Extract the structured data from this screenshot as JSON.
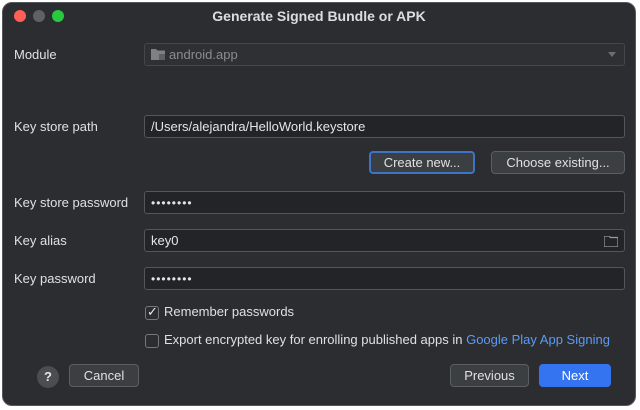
{
  "window": {
    "title": "Generate Signed Bundle or APK"
  },
  "icons": {
    "close": "close-traffic-light-icon",
    "minimize": "minimize-traffic-light-icon",
    "maximize": "maximize-traffic-light-icon",
    "module": "module-folder-icon",
    "browse": "folder-browse-icon",
    "help": "help-icon"
  },
  "form": {
    "module": {
      "label": "Module",
      "value": "android.app"
    },
    "keystore_path": {
      "label": "Key store path",
      "value": "/Users/alejandra/HelloWorld.keystore"
    },
    "create_new_label": "Create new...",
    "choose_existing_label": "Choose existing...",
    "keystore_password": {
      "label": "Key store password",
      "value": "••••••••"
    },
    "key_alias": {
      "label": "Key alias",
      "value": "key0"
    },
    "key_password": {
      "label": "Key password",
      "value": "••••••••"
    },
    "remember_passwords": {
      "label": "Remember passwords",
      "checked": true
    },
    "export_encrypted": {
      "label": "Export encrypted key for enrolling published apps in",
      "link": "Google Play App Signing",
      "checked": false
    }
  },
  "footer": {
    "help_label": "?",
    "cancel_label": "Cancel",
    "previous_label": "Previous",
    "next_label": "Next"
  },
  "colors": {
    "accent": "#3574f0",
    "link": "#5b9bf5",
    "background": "#2b2d30"
  }
}
